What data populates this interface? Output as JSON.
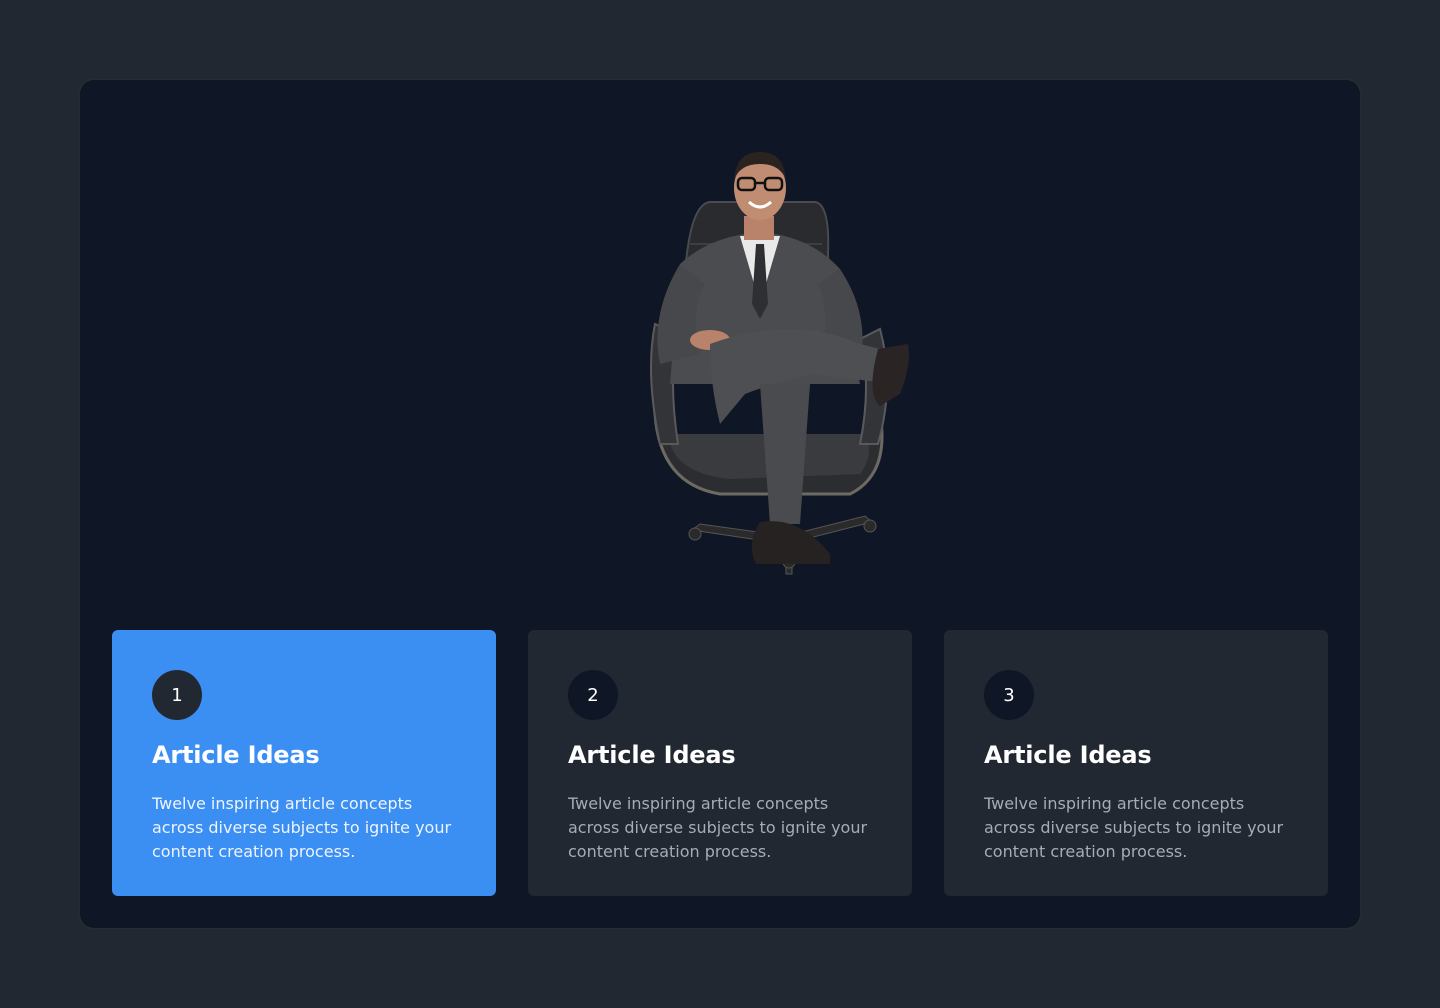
{
  "hero": {
    "image": "businessman-in-office-chair-illustration"
  },
  "cards": [
    {
      "number": "1",
      "title": "Article Ideas",
      "description": "Twelve inspiring article concepts across diverse subjects to ignite your content creation process.",
      "active": true
    },
    {
      "number": "2",
      "title": "Article Ideas",
      "description": "Twelve inspiring article concepts across diverse subjects to ignite your content creation process.",
      "active": false
    },
    {
      "number": "3",
      "title": "Article Ideas",
      "description": "Twelve inspiring article concepts across diverse subjects to ignite your content creation process.",
      "active": false
    }
  ],
  "colors": {
    "page_background": "#222831",
    "panel_background": "#0f1625",
    "card_background": "#222831",
    "active_card_background": "#3b8ef2",
    "text_primary": "#ffffff",
    "text_secondary": "#a6acb6"
  }
}
